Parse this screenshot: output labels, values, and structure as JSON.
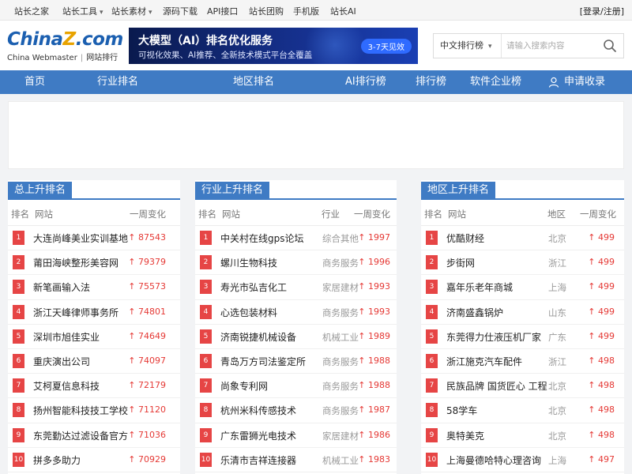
{
  "topbar": {
    "links": [
      {
        "label": "站长之家",
        "has_caret": false
      },
      {
        "label": "站长工具",
        "has_caret": true
      },
      {
        "label": "站长素材",
        "has_caret": true
      },
      {
        "label": "源码下载",
        "has_caret": false
      },
      {
        "label": "API接口",
        "has_caret": false
      },
      {
        "label": "站长团购",
        "has_caret": false
      },
      {
        "label": "手机版",
        "has_caret": false
      },
      {
        "label": "站长AI",
        "has_caret": false
      }
    ],
    "login": "[登录/注册]"
  },
  "logo": {
    "part1": "China",
    "part2": "Z",
    "part3": ".com",
    "sub_en": "China Webmaster",
    "sub_sep": "|",
    "sub_cn": "网站排行"
  },
  "banner": {
    "title": "大模型（AI）排名优化服务",
    "subtitle": "可视化效果、AI推荐、全新技术模式平台全覆盖",
    "button": "3-7天见效"
  },
  "search": {
    "selected": "中文排行榜",
    "placeholder": "请输入搜索内容"
  },
  "nav": {
    "items": [
      "首页",
      "行业排名",
      "地区排名",
      "AI排行榜",
      "排行榜",
      "软件企业榜",
      "申请收录"
    ]
  },
  "panels": {
    "total": {
      "title": "总上升排名",
      "headers": {
        "rank": "排名",
        "site": "网站",
        "change": "一周变化"
      },
      "rows": [
        {
          "rank": "1",
          "name": "大连尚峰美业实训基地",
          "change": "↑ 87543"
        },
        {
          "rank": "2",
          "name": "莆田海峡整形美容网",
          "change": "↑ 79379"
        },
        {
          "rank": "3",
          "name": "新笔画输入法",
          "change": "↑ 75573"
        },
        {
          "rank": "4",
          "name": "浙江天峰律师事务所",
          "change": "↑ 74801"
        },
        {
          "rank": "5",
          "name": "深圳市旭佳实业",
          "change": "↑ 74649"
        },
        {
          "rank": "6",
          "name": "重庆演出公司",
          "change": "↑ 74097"
        },
        {
          "rank": "7",
          "name": "艾柯夏信息科技",
          "change": "↑ 72179"
        },
        {
          "rank": "8",
          "name": "扬州智能科技技工学校",
          "change": "↑ 71120"
        },
        {
          "rank": "9",
          "name": "东莞勤达过滤设备官方",
          "change": "↑ 71036"
        },
        {
          "rank": "10",
          "name": "拼多多助力",
          "change": "↑ 70929"
        }
      ]
    },
    "industry": {
      "title": "行业上升排名",
      "headers": {
        "rank": "排名",
        "site": "网站",
        "cat": "行业",
        "change": "一周变化"
      },
      "rows": [
        {
          "rank": "1",
          "name": "中关村在线gps论坛",
          "cat": "综合其他",
          "change": "↑ 1997"
        },
        {
          "rank": "2",
          "name": "螺川生物科技",
          "cat": "商务服务",
          "change": "↑ 1996"
        },
        {
          "rank": "3",
          "name": "寿光市弘吉化工",
          "cat": "家居建材",
          "change": "↑ 1993"
        },
        {
          "rank": "4",
          "name": "心选包装材料",
          "cat": "商务服务",
          "change": "↑ 1993"
        },
        {
          "rank": "5",
          "name": "济南锐捷机械设备",
          "cat": "机械工业",
          "change": "↑ 1989"
        },
        {
          "rank": "6",
          "name": "青岛万方司法鉴定所",
          "cat": "商务服务",
          "change": "↑ 1988"
        },
        {
          "rank": "7",
          "name": "尚象专利网",
          "cat": "商务服务",
          "change": "↑ 1988"
        },
        {
          "rank": "8",
          "name": "杭州米科传感技术",
          "cat": "商务服务",
          "change": "↑ 1987"
        },
        {
          "rank": "9",
          "name": "广东雷狮光电技术",
          "cat": "家居建材",
          "change": "↑ 1986"
        },
        {
          "rank": "10",
          "name": "乐清市吉祥连接器",
          "cat": "机械工业",
          "change": "↑ 1983"
        }
      ]
    },
    "region": {
      "title": "地区上升排名",
      "headers": {
        "rank": "排名",
        "site": "网站",
        "cat": "地区",
        "change": "一周变化"
      },
      "rows": [
        {
          "rank": "1",
          "name": "优酷财经",
          "cat": "北京",
          "change": "↑ 499"
        },
        {
          "rank": "2",
          "name": "步街网",
          "cat": "浙江",
          "change": "↑ 499"
        },
        {
          "rank": "3",
          "name": "嘉年乐老年商城",
          "cat": "上海",
          "change": "↑ 499"
        },
        {
          "rank": "4",
          "name": "济南盛鑫锅炉",
          "cat": "山东",
          "change": "↑ 499"
        },
        {
          "rank": "5",
          "name": "东莞得力仕液压机厂家",
          "cat": "广东",
          "change": "↑ 499"
        },
        {
          "rank": "6",
          "name": "浙江施克汽车配件",
          "cat": "浙江",
          "change": "↑ 498"
        },
        {
          "rank": "7",
          "name": "民族品牌 国货匠心 工程",
          "cat": "北京",
          "change": "↑ 498"
        },
        {
          "rank": "8",
          "name": "58学车",
          "cat": "北京",
          "change": "↑ 498"
        },
        {
          "rank": "9",
          "name": "奥特美克",
          "cat": "北京",
          "change": "↑ 498"
        },
        {
          "rank": "10",
          "name": "上海曼德哈特心理咨询",
          "cat": "上海",
          "change": "↑ 497"
        }
      ]
    }
  },
  "colors": {
    "nav_blue": "#3f7bc4",
    "rank_red": "#e64545",
    "up_red": "#e53935"
  }
}
